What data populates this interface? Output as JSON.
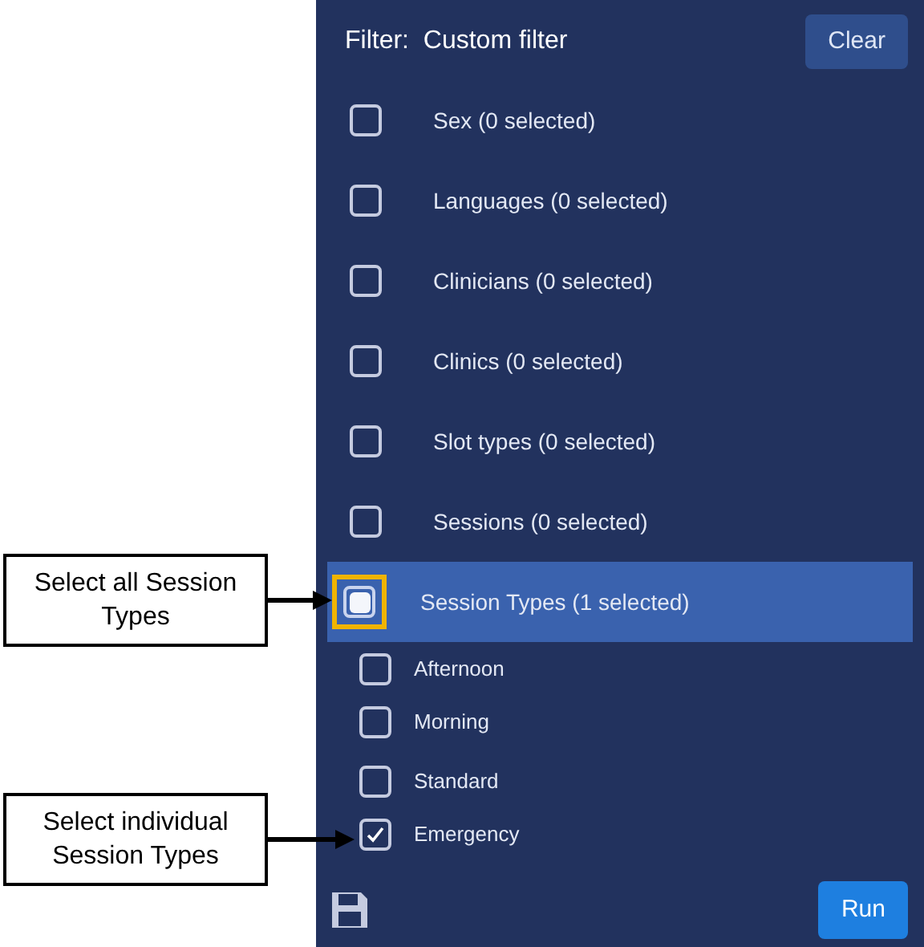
{
  "filter": {
    "label": "Filter:",
    "value": "Custom filter"
  },
  "clear_button": "Clear",
  "categories": [
    {
      "label": "Sex (0 selected)",
      "checked": false,
      "indeterminate": false,
      "selected": false,
      "annotated": false
    },
    {
      "label": "Languages (0 selected)",
      "checked": false,
      "indeterminate": false,
      "selected": false,
      "annotated": false
    },
    {
      "label": "Clinicians (0 selected)",
      "checked": false,
      "indeterminate": false,
      "selected": false,
      "annotated": false
    },
    {
      "label": "Clinics (0 selected)",
      "checked": false,
      "indeterminate": false,
      "selected": false,
      "annotated": false
    },
    {
      "label": "Slot types (0 selected)",
      "checked": false,
      "indeterminate": false,
      "selected": false,
      "annotated": false
    },
    {
      "label": "Sessions (0 selected)",
      "checked": false,
      "indeterminate": false,
      "selected": false,
      "annotated": false
    },
    {
      "label": "Session Types (1 selected)",
      "checked": false,
      "indeterminate": true,
      "selected": true,
      "annotated": true,
      "children": [
        {
          "label": "Afternoon",
          "checked": false
        },
        {
          "label": "Morning",
          "checked": false
        },
        {
          "label": "Standard",
          "checked": false
        },
        {
          "label": "Emergency",
          "checked": true
        }
      ]
    }
  ],
  "run_button": "Run",
  "callouts": [
    "Select all Session Types",
    "Select individual Session Types"
  ]
}
